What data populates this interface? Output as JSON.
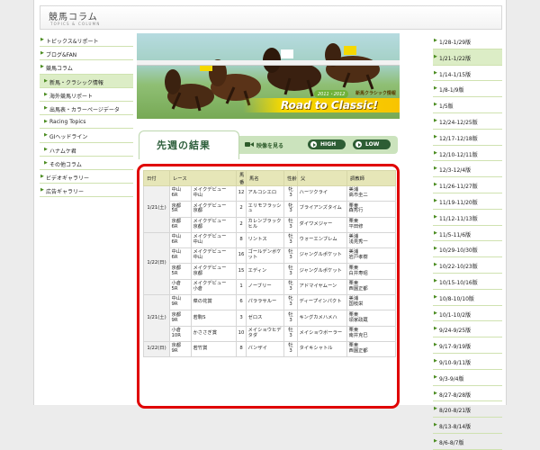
{
  "header": {
    "title": "競馬コラム",
    "subtitle": "TOPICS & COLUMN"
  },
  "left_nav": [
    {
      "label": "トピックス&リポート",
      "level": 1
    },
    {
      "label": "ブログ&FAN",
      "level": 1
    },
    {
      "label": "競馬コラム",
      "level": 1
    },
    {
      "label": "新馬・クラシック情報",
      "level": 2,
      "active": true
    },
    {
      "label": "海外競馬リポート",
      "level": 2
    },
    {
      "label": "出馬表・カラーページデータ",
      "level": 2
    },
    {
      "label": "Racing Topics",
      "level": 2
    },
    {
      "label": "GIヘッドライン",
      "level": 2
    },
    {
      "label": "ハナムケ君",
      "level": 2
    },
    {
      "label": "その他コラム",
      "level": 2
    },
    {
      "label": "ビデオギャラリー",
      "level": 1
    },
    {
      "label": "広告ギャラリー",
      "level": 1
    }
  ],
  "banner": {
    "season": "2011・2012",
    "sublabel": "新馬クラシック情報",
    "title": "Road to Classic!"
  },
  "results_header": {
    "title": "先週の結果",
    "video_label": "映像を見る",
    "high_label": "HIGH",
    "low_label": "LOW"
  },
  "table": {
    "headers": [
      "日付",
      "レース",
      "",
      "馬番",
      "馬名",
      "性齢",
      "父",
      "調教師"
    ],
    "groups": [
      {
        "date": "1/21(土)",
        "rows": [
          [
            "中山\n6R",
            "メイクデビュー\n中山",
            "12",
            "アルコシエロ",
            "牝\n3",
            "ハーツクライ",
            "美浦\n高市圭二"
          ],
          [
            "京都\n5R",
            "メイクデビュー\n京都",
            "2",
            "エリモフラッシュ",
            "牝\n3",
            "ブライアンズタイム",
            "栗東\n森秀行"
          ],
          [
            "京都\n6R",
            "メイクデビュー\n京都",
            "2",
            "カレンブラックヒル",
            "牡\n3",
            "ダイワメジャー",
            "栗東\n平田修"
          ]
        ]
      },
      {
        "date": "1/22(日)",
        "rows": [
          [
            "中山\n6R",
            "メイクデビュー\n中山",
            "8",
            "リントス",
            "牡\n3",
            "ウォーエンブレム",
            "美浦\n浅見秀一"
          ],
          [
            "中山\n6R",
            "メイクデビュー\n中山",
            "16",
            "ゴールデンボケット",
            "牡\n3",
            "ジャングルポケット",
            "美浦\n岩戸孝樹"
          ],
          [
            "京都\n5R",
            "メイクデビュー\n京都",
            "15",
            "エディン",
            "牡\n3",
            "ジャングルポケット",
            "栗東\n白井寿昭"
          ],
          [
            "小倉\n5R",
            "メイクデビュー\n小倉",
            "1",
            "ノーブリー",
            "牝\n3",
            "アドマイヤムーン",
            "栗東\n西園正都"
          ]
        ]
      },
      {
        "date": "1/21(土)",
        "rows": [
          [
            "中山\n9R",
            "菜の花賞",
            "6",
            "パララサルー",
            "牝\n3",
            "ディープインパクト",
            "美浦\n国枝栄"
          ],
          [
            "京都\n9R",
            "若駒S",
            "3",
            "ゼロス",
            "牡\n3",
            "キングカメハメハ",
            "栗東\n領家政蔵"
          ],
          [
            "小倉\n10R",
            "かささぎ賞",
            "10",
            "メイショウヒデタダ",
            "牡\n3",
            "メイショウボーラー",
            "栗東\n南井克巳"
          ]
        ]
      },
      {
        "date": "1/22(日)",
        "rows": [
          [
            "京都\n9R",
            "若竹賞",
            "8",
            "バンザイ",
            "牡\n3",
            "タイキシャトル",
            "栗東\n西園正都"
          ]
        ]
      }
    ]
  },
  "right_nav": [
    {
      "label": "1/28-1/29版"
    },
    {
      "label": "1/21-1/22版",
      "active": true
    },
    {
      "label": "1/14-1/15版"
    },
    {
      "label": "1/8-1/9版"
    },
    {
      "label": "1/5版"
    },
    {
      "label": "12/24-12/25版"
    },
    {
      "label": "12/17-12/18版"
    },
    {
      "label": "12/10-12/11版"
    },
    {
      "label": "12/3-12/4版"
    },
    {
      "label": "11/26-11/27版"
    },
    {
      "label": "11/19-11/20版"
    },
    {
      "label": "11/12-11/13版"
    },
    {
      "label": "11/5-11/6版"
    },
    {
      "label": "10/29-10/30版"
    },
    {
      "label": "10/22-10/23版"
    },
    {
      "label": "10/15-10/16版"
    },
    {
      "label": "10/8-10/10版"
    },
    {
      "label": "10/1-10/2版"
    },
    {
      "label": "9/24-9/25版"
    },
    {
      "label": "9/17-9/19版"
    },
    {
      "label": "9/10-9/11版"
    },
    {
      "label": "9/3-9/4版"
    },
    {
      "label": "8/27-8/28版"
    },
    {
      "label": "8/20-8/21版"
    },
    {
      "label": "8/13-8/14版"
    },
    {
      "label": "8/6-8/7版"
    }
  ]
}
